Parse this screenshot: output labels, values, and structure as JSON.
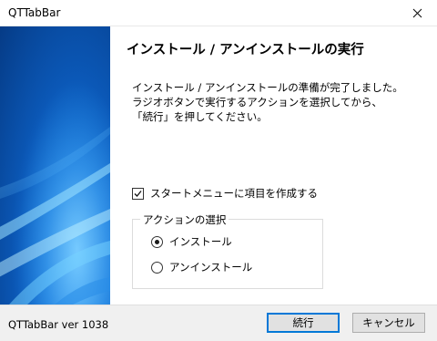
{
  "window": {
    "title": "QTTabBar"
  },
  "page": {
    "heading": "インストール / アンインストールの実行",
    "description": [
      "インストール / アンインストールの準備が完了しました。",
      "ラジオボタンで実行するアクションを選択してから、",
      "「続行」を押してください。"
    ],
    "start_menu_checkbox": {
      "label": "スタートメニューに項目を作成する",
      "checked": true
    },
    "action_group": {
      "title": "アクションの選択",
      "options": [
        {
          "label": "インストール",
          "selected": true
        },
        {
          "label": "アンインストール",
          "selected": false
        }
      ]
    }
  },
  "footer": {
    "version": "QTTabBar ver 1038",
    "continue_label": "続行",
    "cancel_label": "キャンセル"
  },
  "colors": {
    "accent": "#0078d7",
    "footer_bg": "#f0f0f0"
  }
}
